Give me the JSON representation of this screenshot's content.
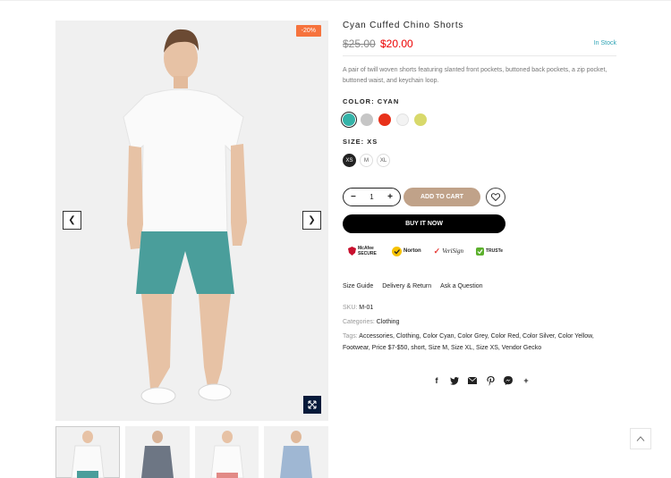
{
  "gallery": {
    "badge": "-20%",
    "thumb_count": 4
  },
  "product": {
    "title": "Cyan Cuffed Chino Shorts",
    "old_price": "$25.00",
    "new_price": "$20.00",
    "stock": "In Stock",
    "description": "A pair of twill woven shorts featuring slanted front pockets, buttoned back pockets, a zip pocket, buttoned waist, and keychain loop."
  },
  "color": {
    "label": "COLOR:",
    "selected": "CYAN",
    "swatches": [
      {
        "name": "Cyan",
        "hex": "#34b3a8"
      },
      {
        "name": "Grey",
        "hex": "#c6c6c6"
      },
      {
        "name": "Red",
        "hex": "#e8311a"
      },
      {
        "name": "Silver",
        "hex": "#f3f3f3"
      },
      {
        "name": "Yellow",
        "hex": "#d8d96b"
      }
    ]
  },
  "size": {
    "label": "SIZE:",
    "selected": "XS",
    "options": [
      "XS",
      "M",
      "XL"
    ]
  },
  "cart": {
    "quantity": "1",
    "minus": "−",
    "plus": "+",
    "add_to_cart": "ADD TO CART",
    "buy_now": "BUY IT NOW"
  },
  "trust_badges": {
    "mcafee": "McAfee SECURE",
    "norton": "Norton",
    "verisign": "VeriSign",
    "truste": "TRUSTe"
  },
  "links": {
    "size_guide": "Size Guide",
    "delivery": "Delivery & Return",
    "ask": "Ask a Question"
  },
  "meta": {
    "sku_label": "SKU:",
    "sku": "M-01",
    "categories_label": "Categories:",
    "category": "Clothing",
    "tags_label": "Tags:",
    "tags": "Accessories, Clothing, Color Cyan, Color Grey, Color Red, Color Silver, Color Yellow, Footwear, Price $7-$50, short, Size M, Size XL, Size XS, Vendor Gecko"
  },
  "colors": {
    "price_red": "#ec0101",
    "stock_teal": "#2fa3b5",
    "add_cart_bg": "#c0a289",
    "badge_orange": "#f6733d"
  }
}
